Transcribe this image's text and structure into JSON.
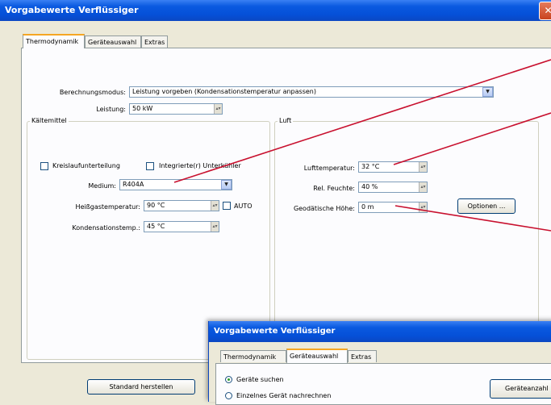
{
  "window": {
    "title": "Vorgabewerte Verflüssiger",
    "close_glyph": "✕",
    "tabs": [
      {
        "label": "Thermodynamik",
        "active": true
      },
      {
        "label": "Geräteauswahl",
        "active": false
      },
      {
        "label": "Extras",
        "active": false
      }
    ]
  },
  "calculation": {
    "mode_label": "Berechnungsmodus:",
    "mode_value": "Leistung vorgeben (Kondensationstemperatur anpassen)",
    "power_label": "Leistung:",
    "power_value": "50 kW"
  },
  "refrigerant": {
    "group_title": "Kältemittel",
    "circuit_split_label": "Kreislaufunterteilung",
    "circuit_split_checked": false,
    "subcooler_label": "Integrierte(r) Unterkühler",
    "subcooler_checked": false,
    "medium_label": "Medium:",
    "medium_value": "R404A",
    "hotgas_label": "Heißgastemperatur:",
    "hotgas_value": "90 °C",
    "auto_label": "AUTO",
    "auto_checked": false,
    "condensation_label": "Kondensationstemp.:",
    "condensation_value": "45 °C"
  },
  "air": {
    "group_title": "Luft",
    "temperature_label": "Lufttemperatur:",
    "temperature_value": "32 °C",
    "humidity_label": "Rel. Feuchte:",
    "humidity_value": "40 %",
    "altitude_label": "Geodätische Höhe:",
    "altitude_value": "0 m",
    "options_button": "Optionen ..."
  },
  "footer": {
    "default_button": "Standard herstellen"
  },
  "overlay_window": {
    "title": "Vorgabewerte Verflüssiger",
    "tabs": [
      {
        "label": "Thermodynamik",
        "active": false
      },
      {
        "label": "Geräteauswahl",
        "active": true
      },
      {
        "label": "Extras",
        "active": false
      }
    ],
    "radio_search_label": "Geräte suchen",
    "radio_search_selected": true,
    "radio_single_label": "Einzelnes Gerät nachrechnen",
    "radio_single_selected": false,
    "device_count_button": "Geräteanzahl"
  },
  "colors": {
    "annotation_arrow": "#c8102e",
    "titlebar": "#0550d8",
    "dialog_bg": "#ece9d8"
  }
}
